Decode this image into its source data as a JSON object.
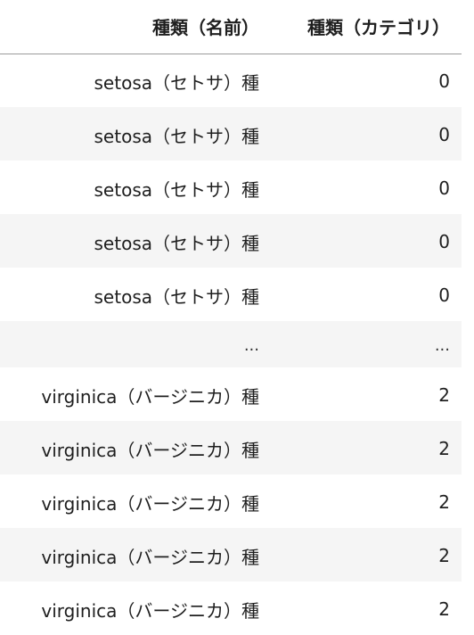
{
  "header": {
    "col_name": "種類（名前）",
    "col_category": "種類（カテゴリ）"
  },
  "rows": [
    {
      "name": "setosa（セトサ）種",
      "category": "0"
    },
    {
      "name": "setosa（セトサ）種",
      "category": "0"
    },
    {
      "name": "setosa（セトサ）種",
      "category": "0"
    },
    {
      "name": "setosa（セトサ）種",
      "category": "0"
    },
    {
      "name": "setosa（セトサ）種",
      "category": "0"
    },
    {
      "name": "...",
      "category": "..."
    },
    {
      "name": "virginica（バージニカ）種",
      "category": "2"
    },
    {
      "name": "virginica（バージニカ）種",
      "category": "2"
    },
    {
      "name": "virginica（バージニカ）種",
      "category": "2"
    },
    {
      "name": "virginica（バージニカ）種",
      "category": "2"
    },
    {
      "name": "virginica（バージニカ）種",
      "category": "2"
    }
  ]
}
